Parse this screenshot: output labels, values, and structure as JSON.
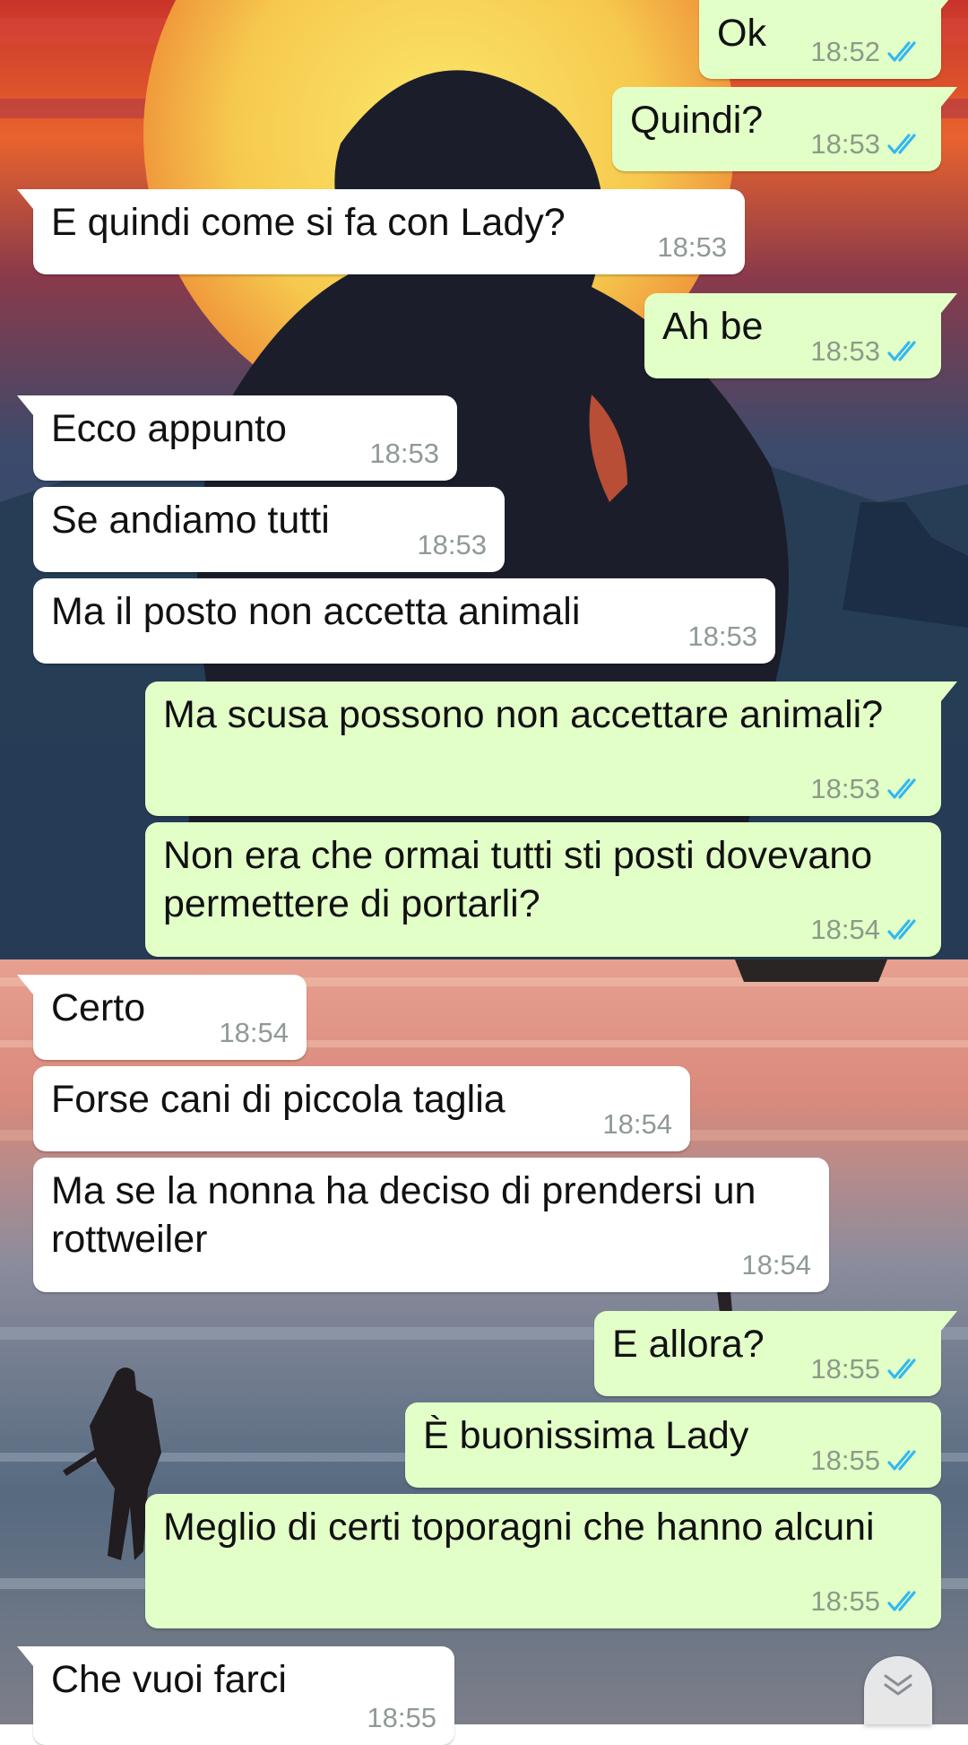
{
  "colors": {
    "incoming_bubble": "#ffffff",
    "outgoing_bubble": "#e2ffc7",
    "read_ticks": "#34b7f1",
    "timestamp": "#8f9a96"
  },
  "messages": [
    {
      "direction": "out",
      "text": "Ok",
      "time": "18:52",
      "status": "read"
    },
    {
      "direction": "out",
      "text": "Quindi?",
      "time": "18:53",
      "status": "read"
    },
    {
      "direction": "in",
      "text": "E quindi come si fa con Lady?",
      "time": "18:53"
    },
    {
      "direction": "out",
      "text": "Ah be",
      "time": "18:53",
      "status": "read"
    },
    {
      "direction": "in",
      "text": "Ecco appunto",
      "time": "18:53"
    },
    {
      "direction": "in",
      "text": "Se andiamo tutti",
      "time": "18:53"
    },
    {
      "direction": "in",
      "text": "Ma il posto non accetta animali",
      "time": "18:53"
    },
    {
      "direction": "out",
      "text": "Ma scusa possono non accettare animali?",
      "time": "18:53",
      "status": "read"
    },
    {
      "direction": "out",
      "text": "Non era che ormai tutti sti posti dovevano permettere di portarli?",
      "time": "18:54",
      "status": "read"
    },
    {
      "direction": "in",
      "text": "Certo",
      "time": "18:54"
    },
    {
      "direction": "in",
      "text": "Forse cani di piccola taglia",
      "time": "18:54"
    },
    {
      "direction": "in",
      "text": "Ma se la nonna ha deciso di prendersi un rottweiler",
      "time": "18:54"
    },
    {
      "direction": "out",
      "text": "E allora?",
      "time": "18:55",
      "status": "read"
    },
    {
      "direction": "out",
      "text": "È buonissima Lady",
      "time": "18:55",
      "status": "read"
    },
    {
      "direction": "out",
      "text": "Meglio di certi toporagni che hanno alcuni",
      "time": "18:55",
      "status": "read"
    },
    {
      "direction": "in",
      "text": "Che vuoi farci",
      "time": "18:55"
    }
  ],
  "icons": {
    "read_receipt": "double-check-icon",
    "scroll_down": "double-chevron-down-icon"
  }
}
